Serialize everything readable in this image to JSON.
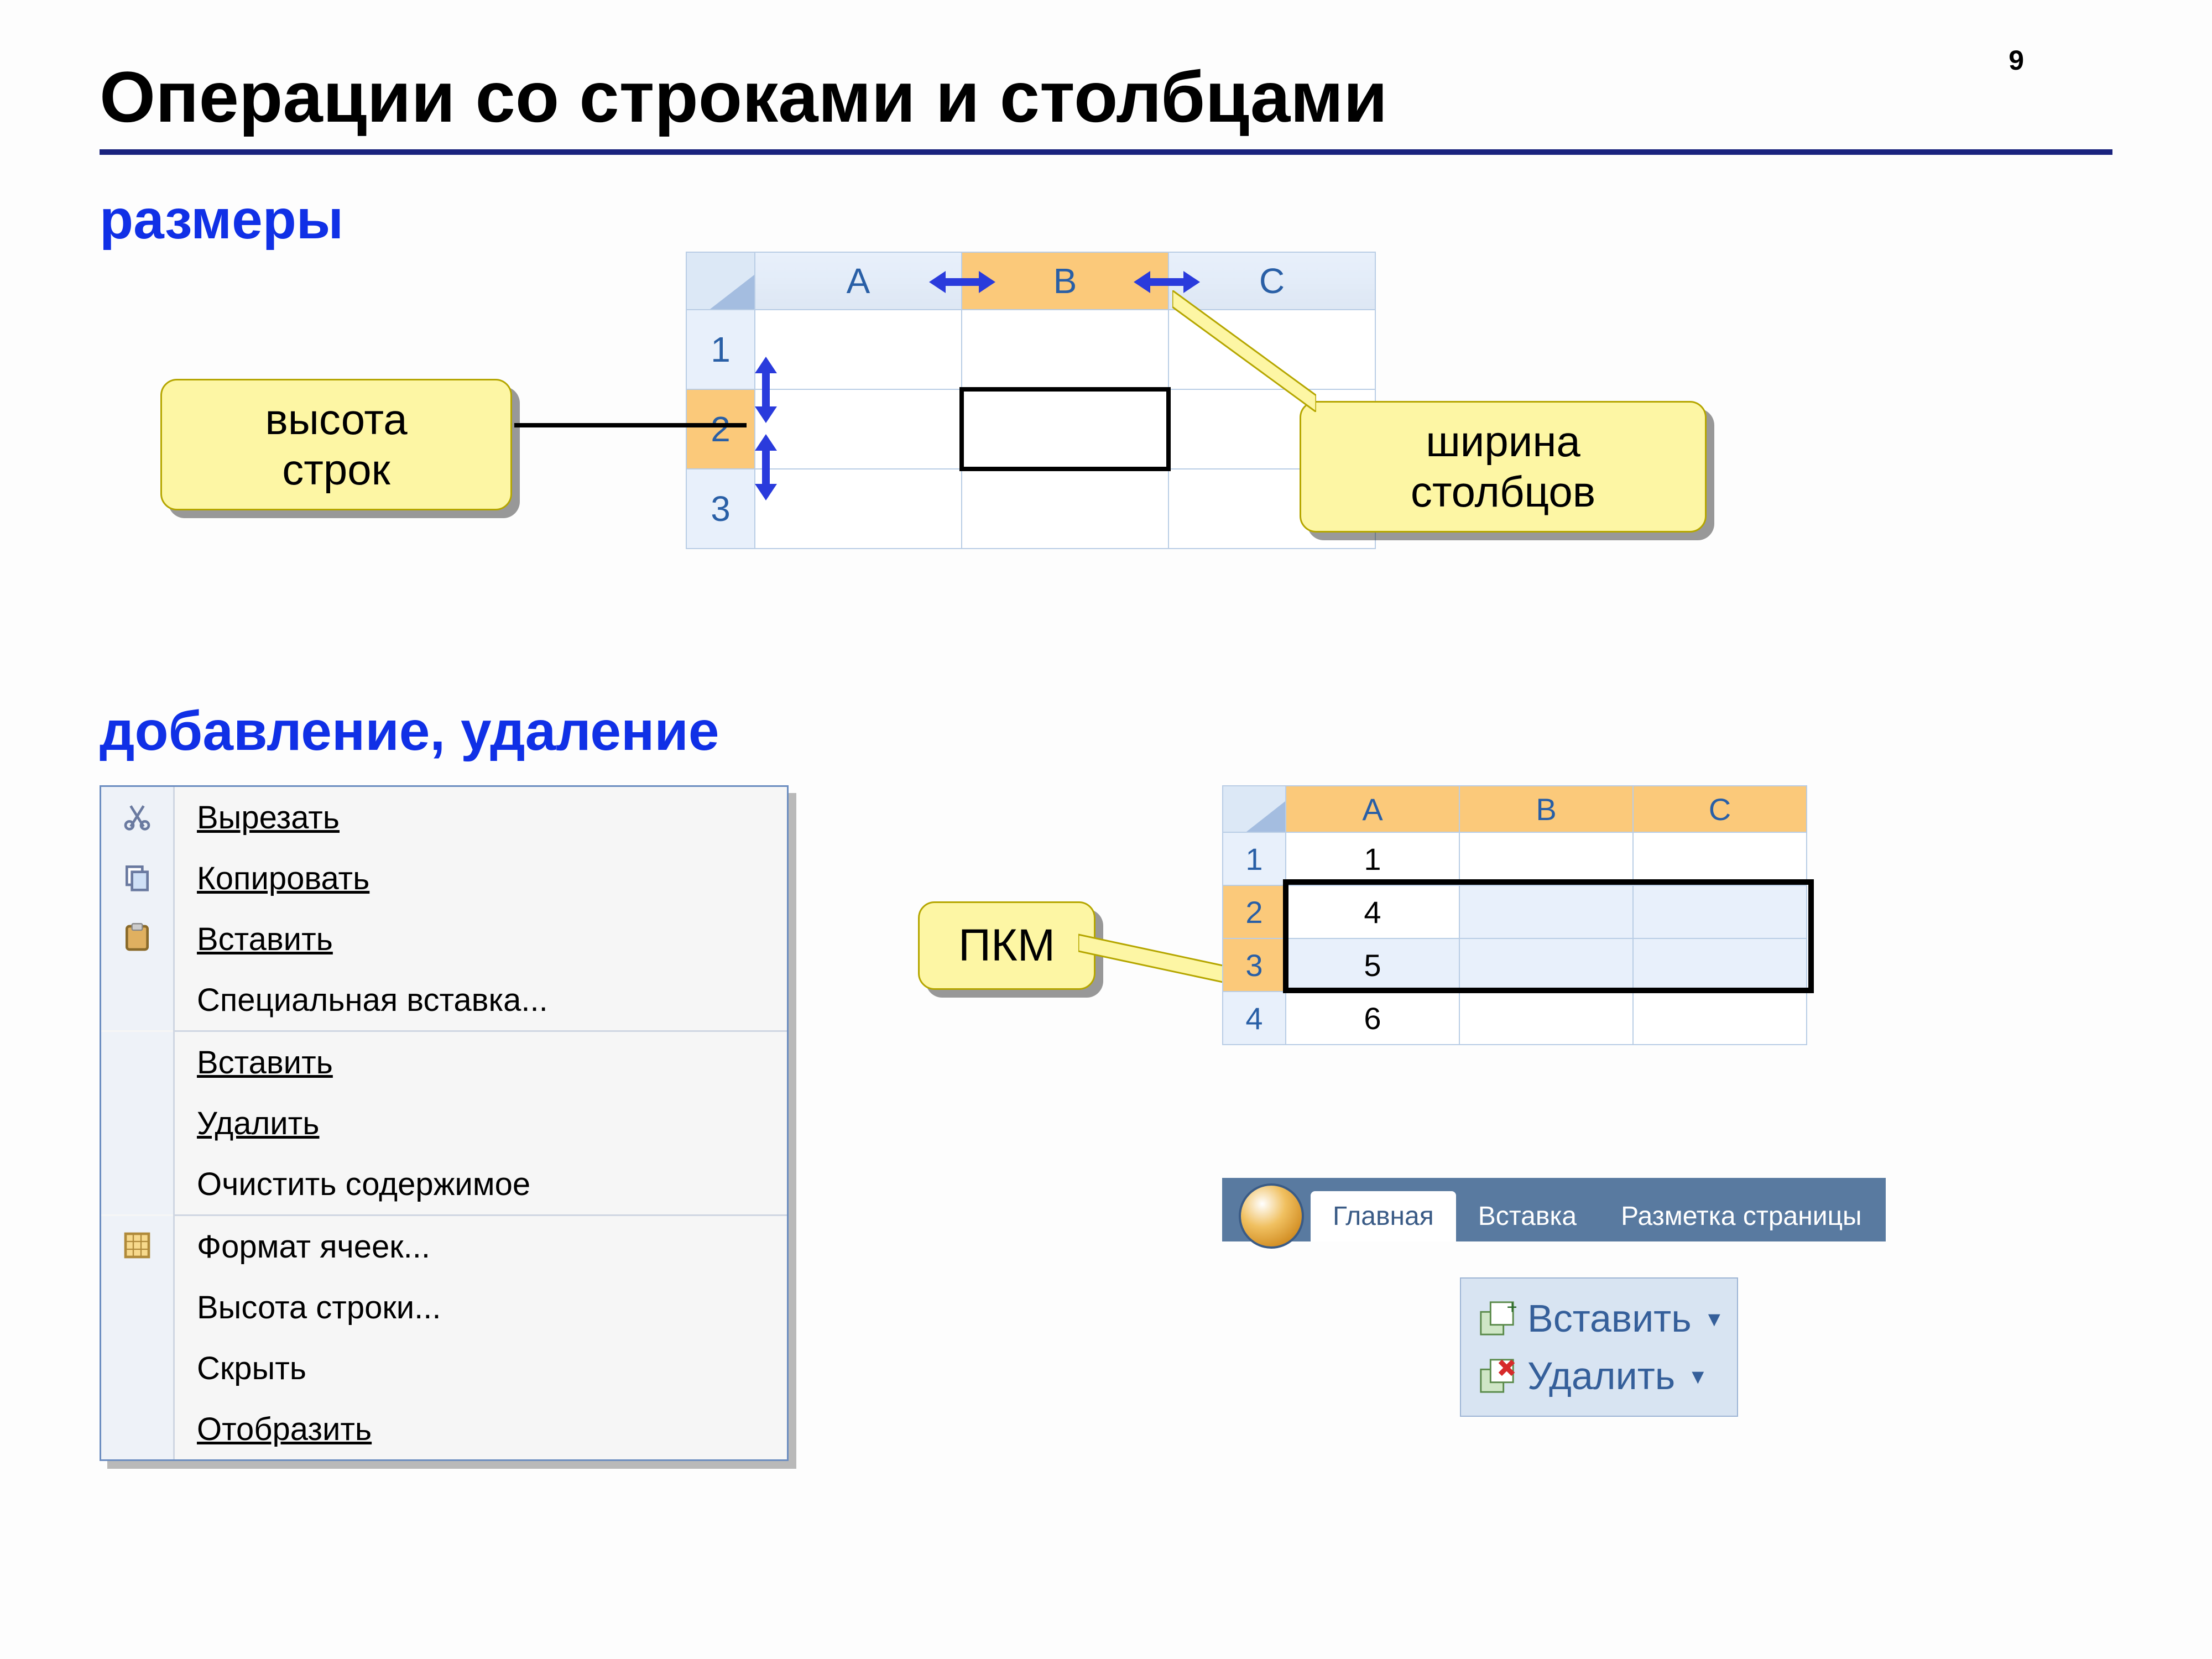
{
  "page_number": "9",
  "title": "Операции со строками и столбцами",
  "section_sizes": "размеры",
  "section_add_del": "добавление, удаление",
  "callout_row_height": "высота\nстрок",
  "callout_col_width": "ширина\nстолбцов",
  "callout_pkm": "ПКМ",
  "sheet1": {
    "cols": [
      "A",
      "B",
      "C"
    ],
    "rows": [
      "1",
      "2",
      "3"
    ]
  },
  "sheet2": {
    "cols": [
      "A",
      "B",
      "C"
    ],
    "rows": [
      "1",
      "2",
      "3",
      "4"
    ],
    "colA_values": [
      "1",
      "4",
      "5",
      "6"
    ]
  },
  "context_menu": {
    "cut": "Вырезать",
    "copy": "Копировать",
    "paste": "Вставить",
    "paste_special": "Специальная вставка...",
    "insert": "Вставить",
    "delete": "Удалить",
    "clear": "Очистить содержимое",
    "format_cells": "Формат ячеек...",
    "row_height": "Высота строки...",
    "hide": "Скрыть",
    "show": "Отобразить"
  },
  "ribbon": {
    "tab_home": "Главная",
    "tab_insert": "Вставка",
    "tab_layout": "Разметка страницы"
  },
  "cell_buttons": {
    "insert": "Вставить",
    "delete": "Удалить"
  }
}
